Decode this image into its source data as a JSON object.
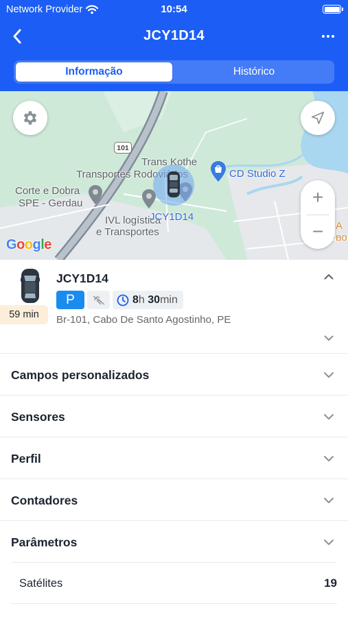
{
  "status_bar": {
    "carrier": "Network Provider",
    "time": "10:54"
  },
  "nav": {
    "title": "JCY1D14"
  },
  "tabs": [
    {
      "label": "Informação",
      "active": true
    },
    {
      "label": "Histórico",
      "active": false
    }
  ],
  "map": {
    "labels": {
      "trans_kothe_1": "Trans Kothe",
      "trans_kothe_2": "Transportes Rodoviários",
      "cd_studio": "CD Studio Z",
      "corte_1": "Corte e Dobra",
      "corte_2": "SPE - Gerdau",
      "ivl_1": "IVL logística",
      "ivl_2": "e Transportes",
      "vehicle": "JCY1D14",
      "edge_1": "A e",
      "edge_2": "no",
      "route": "101"
    },
    "google": [
      "G",
      "o",
      "o",
      "g",
      "l",
      "e"
    ],
    "google_colors": [
      "#4285F4",
      "#EA4335",
      "#FBBC05",
      "#4285F4",
      "#34A853",
      "#EA4335"
    ],
    "zoom_in": "+",
    "zoom_out": "−"
  },
  "vehicle": {
    "name": "JCY1D14",
    "last_update": "59 min",
    "status_letter": "P",
    "duration_hours": "8",
    "duration_hours_unit": "h",
    "duration_minutes": "30",
    "duration_minutes_unit": "min",
    "address": "Br-101, Cabo De Santo Agostinho, PE"
  },
  "sections": [
    {
      "label": "Campos personalizados"
    },
    {
      "label": "Sensores"
    },
    {
      "label": "Perfil"
    },
    {
      "label": "Contadores"
    },
    {
      "label": "Parâmetros"
    }
  ],
  "parameters": [
    {
      "label": "Satélites",
      "value": "19"
    }
  ],
  "colors": {
    "primary": "#1c5ef5",
    "status_p": "#1a8cf0",
    "badge_bg": "#fdeeda",
    "map_bg": "#cfe9d9"
  }
}
